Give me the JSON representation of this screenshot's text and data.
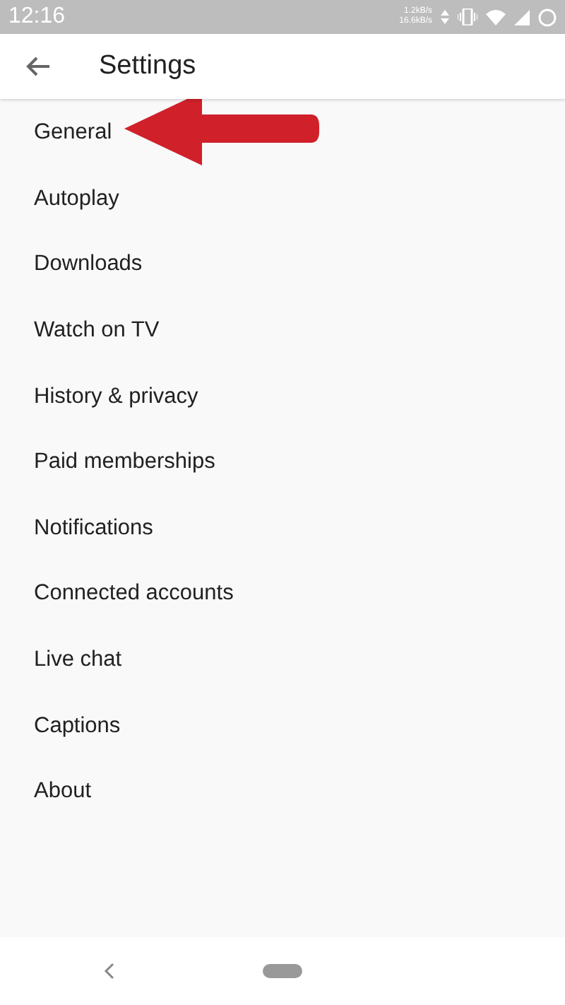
{
  "status_bar": {
    "time": "12:16",
    "upload_speed": "1.2kB/s",
    "download_speed": "16.6kB/s"
  },
  "app_bar": {
    "title": "Settings"
  },
  "items": [
    {
      "label": "General"
    },
    {
      "label": "Autoplay"
    },
    {
      "label": "Downloads"
    },
    {
      "label": "Watch on TV"
    },
    {
      "label": "History & privacy"
    },
    {
      "label": "Paid memberships"
    },
    {
      "label": "Notifications"
    },
    {
      "label": "Connected accounts"
    },
    {
      "label": "Live chat"
    },
    {
      "label": "Captions"
    },
    {
      "label": "About"
    }
  ]
}
